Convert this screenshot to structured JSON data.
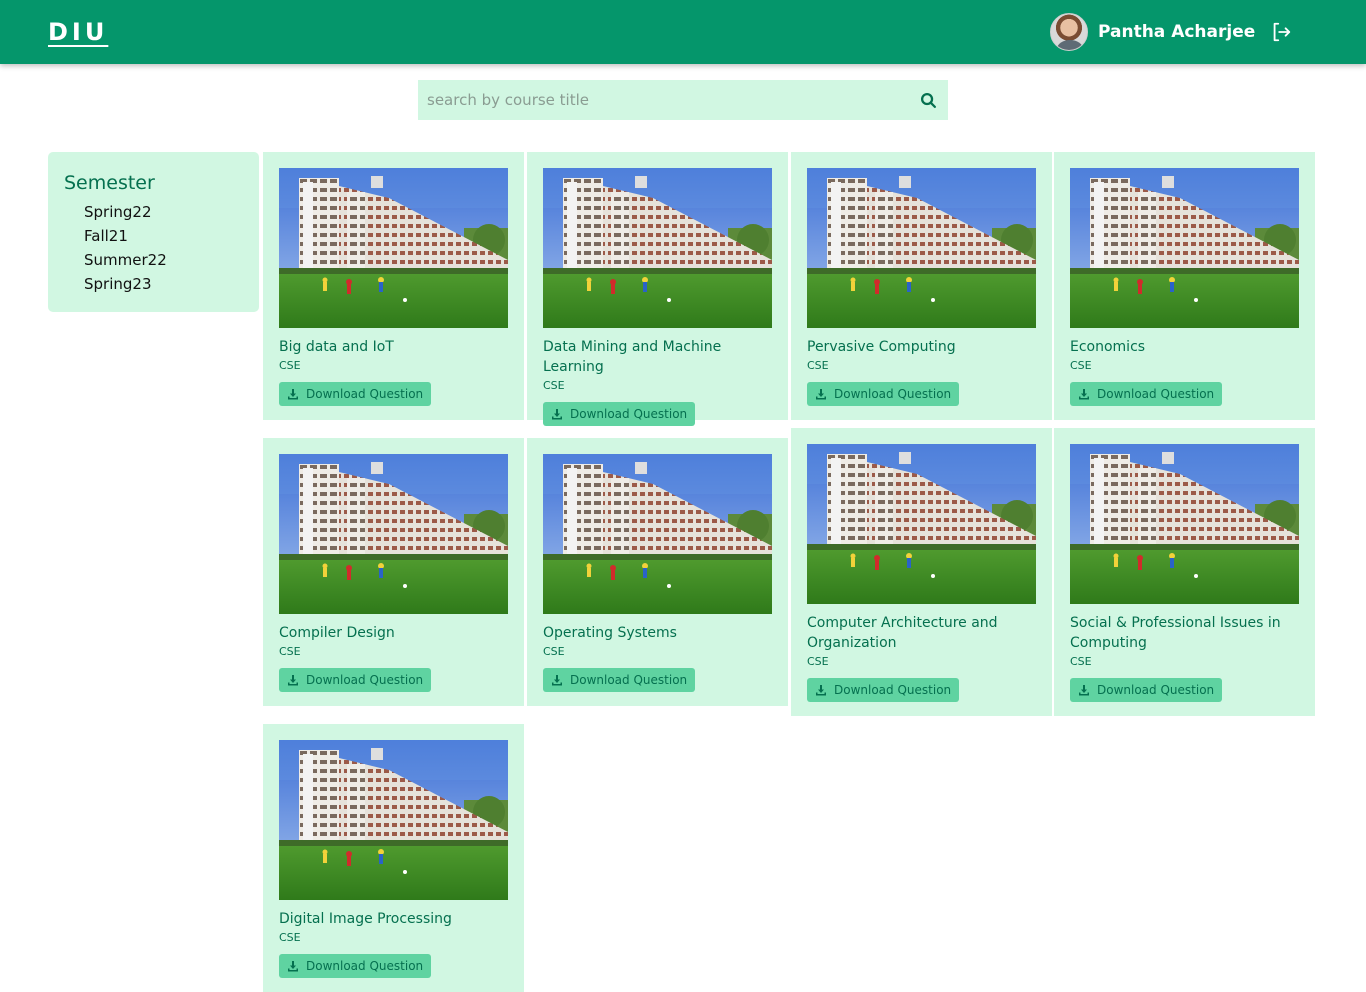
{
  "header": {
    "logo": "DIU",
    "user_name": "Pantha Acharjee"
  },
  "search": {
    "placeholder": "search by course title"
  },
  "sidebar": {
    "title": "Semester",
    "items": [
      "Spring22",
      "Fall21",
      "Summer22",
      "Spring23"
    ]
  },
  "courses": [
    {
      "title": "Big data and IoT",
      "dept": "CSE",
      "button": "Download Question"
    },
    {
      "title": "Data Mining and Machine Learning",
      "dept": "CSE",
      "button": "Download Question"
    },
    {
      "title": "Pervasive Computing",
      "dept": "CSE",
      "button": "Download Question"
    },
    {
      "title": "Economics",
      "dept": "CSE",
      "button": "Download Question"
    },
    {
      "title": "Compiler Design",
      "dept": "CSE",
      "button": "Download Question"
    },
    {
      "title": "Operating Systems",
      "dept": "CSE",
      "button": "Download Question"
    },
    {
      "title": "Computer Architecture and Organization",
      "dept": "CSE",
      "button": "Download Question"
    },
    {
      "title": "Social & Professional Issues in Computing",
      "dept": "CSE",
      "button": "Download Question"
    },
    {
      "title": "Digital Image Processing",
      "dept": "CSE",
      "button": "Download Question"
    }
  ],
  "colors": {
    "brand": "#05966b",
    "panel": "#d1f7e2",
    "button": "#5fd3a1",
    "text_accent": "#05704f"
  },
  "icons": {
    "search": "search-icon",
    "logout": "logout-icon",
    "download": "download-icon"
  }
}
